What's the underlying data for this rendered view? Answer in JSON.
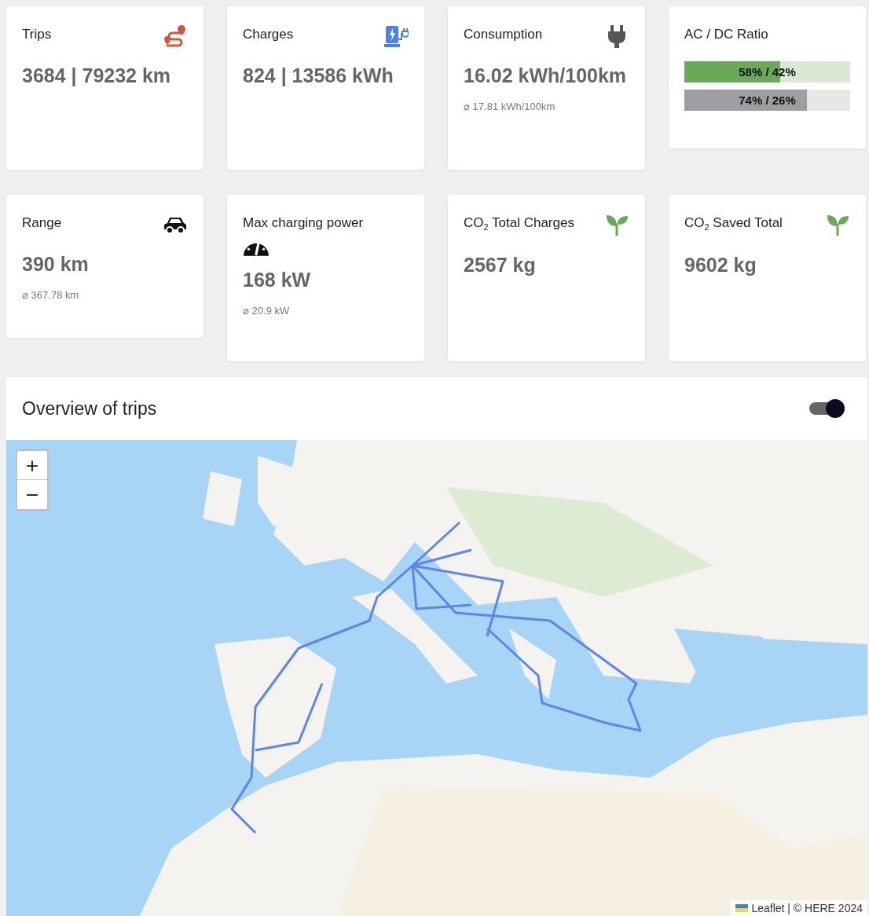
{
  "cards": [
    {
      "kind": "stat",
      "title": "Trips",
      "value": "3684 | 79232 km"
    },
    {
      "kind": "stat",
      "title": "Charges",
      "value": "824 | 13586 kWh"
    },
    {
      "kind": "stat",
      "title": "Consumption",
      "value": "16.02 kWh/100km",
      "sub": "⌀ 17.81 kWh/100km"
    },
    {
      "kind": "ratio",
      "title": "AC / DC Ratio",
      "bars": [
        {
          "label": "58% / 42%",
          "level": 0.58,
          "color": "#6aa85a"
        },
        {
          "label": "74% / 26%",
          "level": 0.74,
          "color": "#9e9ea2"
        }
      ]
    },
    {
      "kind": "stat",
      "title": "Range",
      "value": "390 km",
      "sub": "⌀ 367.78 km"
    },
    {
      "kind": "stat",
      "title": "Max charging power",
      "value": "168 kW",
      "sub": "⌀ 20.9 kW"
    },
    {
      "kind": "stat",
      "title": "CO$_{2}$ Total Charges",
      "value": "2567 kg"
    },
    {
      "kind": "stat",
      "title": "CO$_{2}$ Saved Total",
      "value": "9602 kg"
    }
  ],
  "map_section": {
    "title": "Overview of trips",
    "toggle": {
      "on": true
    },
    "zoom_in": "+",
    "zoom_out": "−",
    "attribution": "Leaflet | © HERE 2024"
  }
}
